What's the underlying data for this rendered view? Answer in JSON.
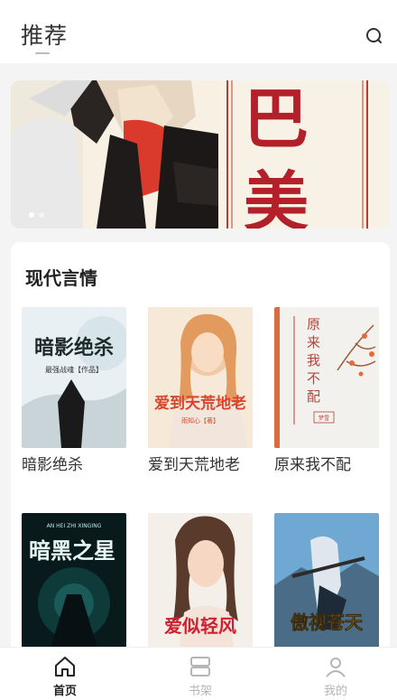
{
  "header": {
    "title": "推荐"
  },
  "banner": {
    "art_text": "巴 美",
    "slide_count": 2,
    "active_slide": 1
  },
  "section": {
    "title": "现代言情",
    "books": [
      {
        "title": "暗影绝杀",
        "cover_text": "暗影绝杀",
        "cover_sub": "最强战魂【作品】"
      },
      {
        "title": "爱到天荒地老",
        "cover_text": "爱到天荒地老",
        "cover_sub": "雨知心【著】"
      },
      {
        "title": "原来我不配",
        "cover_text": "原来我不配",
        "cover_sub": "梦雪"
      },
      {
        "title": "",
        "cover_text": "暗黑之星",
        "cover_sub": "AN HEI ZHI XINGING"
      },
      {
        "title": "",
        "cover_text": "爱似轻风",
        "cover_sub": ""
      },
      {
        "title": "",
        "cover_text": "傲视苍天",
        "cover_sub": ""
      }
    ]
  },
  "tabbar": {
    "items": [
      {
        "label": "首页",
        "icon": "home-icon",
        "active": true
      },
      {
        "label": "书架",
        "icon": "bookshelf-icon",
        "active": false
      },
      {
        "label": "我的",
        "icon": "user-icon",
        "active": false
      }
    ]
  },
  "colors": {
    "accent": "#222222",
    "inactive": "#b5b5b5",
    "background": "#f4f4f4"
  }
}
